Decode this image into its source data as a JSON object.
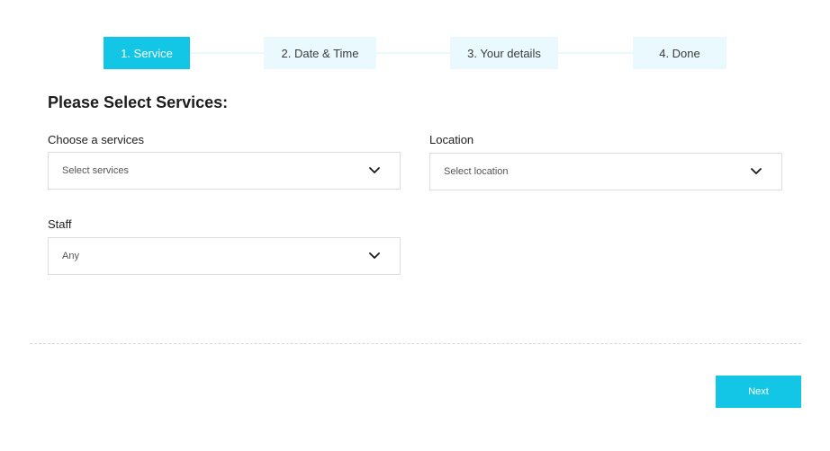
{
  "stepper": {
    "steps": [
      {
        "label": "1. Service",
        "active": true
      },
      {
        "label": "2. Date & Time",
        "active": false
      },
      {
        "label": "3. Your details",
        "active": false
      },
      {
        "label": "4. Done",
        "active": false
      }
    ]
  },
  "form": {
    "heading": "Please Select Services:",
    "services": {
      "label": "Choose a services",
      "value": "Select services"
    },
    "location": {
      "label": "Location",
      "value": "Select location"
    },
    "staff": {
      "label": "Staff",
      "value": "Any"
    }
  },
  "footer": {
    "next_label": "Next"
  },
  "colors": {
    "accent": "#14c6e6",
    "step_inactive_bg": "#e9f9fd"
  }
}
